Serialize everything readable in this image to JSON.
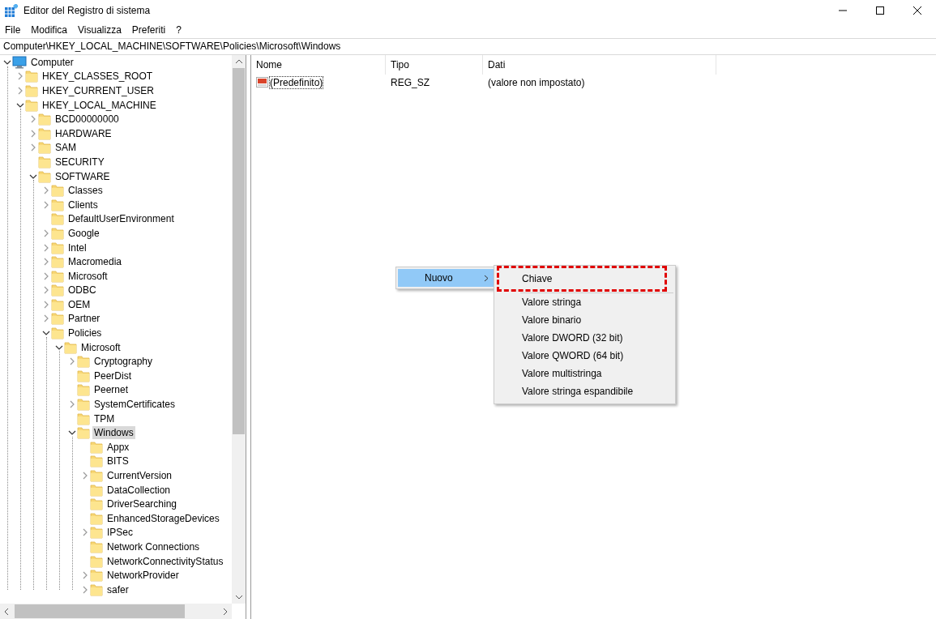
{
  "window": {
    "title": "Editor del Registro di sistema"
  },
  "menu": [
    "File",
    "Modifica",
    "Visualizza",
    "Preferiti",
    "?"
  ],
  "address_bar": {
    "value": "Computer\\HKEY_LOCAL_MACHINE\\SOFTWARE\\Policies\\Microsoft\\Windows"
  },
  "tree": [
    {
      "label": "Computer",
      "kind": "computer",
      "expanded": true,
      "selected": false,
      "children": [
        {
          "label": "HKEY_CLASSES_ROOT",
          "expanded": false,
          "selected": false
        },
        {
          "label": "HKEY_CURRENT_USER",
          "expanded": false,
          "selected": false
        },
        {
          "label": "HKEY_LOCAL_MACHINE",
          "expanded": true,
          "selected": false,
          "children": [
            {
              "label": "BCD00000000",
              "expanded": false,
              "selected": false
            },
            {
              "label": "HARDWARE",
              "expanded": false,
              "selected": false
            },
            {
              "label": "SAM",
              "expanded": false,
              "selected": false
            },
            {
              "label": "SECURITY",
              "selected": false
            },
            {
              "label": "SOFTWARE",
              "expanded": true,
              "selected": false,
              "children": [
                {
                  "label": "Classes",
                  "expanded": false,
                  "selected": false
                },
                {
                  "label": "Clients",
                  "expanded": false,
                  "selected": false
                },
                {
                  "label": "DefaultUserEnvironment",
                  "selected": false
                },
                {
                  "label": "Google",
                  "expanded": false,
                  "selected": false
                },
                {
                  "label": "Intel",
                  "expanded": false,
                  "selected": false
                },
                {
                  "label": "Macromedia",
                  "expanded": false,
                  "selected": false
                },
                {
                  "label": "Microsoft",
                  "expanded": false,
                  "selected": false
                },
                {
                  "label": "ODBC",
                  "expanded": false,
                  "selected": false
                },
                {
                  "label": "OEM",
                  "expanded": false,
                  "selected": false
                },
                {
                  "label": "Partner",
                  "expanded": false,
                  "selected": false
                },
                {
                  "label": "Policies",
                  "expanded": true,
                  "selected": false,
                  "children": [
                    {
                      "label": "Microsoft",
                      "expanded": true,
                      "selected": false,
                      "children": [
                        {
                          "label": "Cryptography",
                          "expanded": false,
                          "selected": false
                        },
                        {
                          "label": "PeerDist",
                          "selected": false
                        },
                        {
                          "label": "Peernet",
                          "selected": false
                        },
                        {
                          "label": "SystemCertificates",
                          "expanded": false,
                          "selected": false
                        },
                        {
                          "label": "TPM",
                          "selected": false
                        },
                        {
                          "label": "Windows",
                          "expanded": true,
                          "selected": true,
                          "children": [
                            {
                              "label": "Appx",
                              "selected": false
                            },
                            {
                              "label": "BITS",
                              "selected": false
                            },
                            {
                              "label": "CurrentVersion",
                              "expanded": false,
                              "selected": false
                            },
                            {
                              "label": "DataCollection",
                              "selected": false
                            },
                            {
                              "label": "DriverSearching",
                              "selected": false
                            },
                            {
                              "label": "EnhancedStorageDevices",
                              "selected": false
                            },
                            {
                              "label": "IPSec",
                              "expanded": false,
                              "selected": false
                            },
                            {
                              "label": "Network Connections",
                              "selected": false
                            },
                            {
                              "label": "NetworkConnectivityStatus",
                              "selected": false
                            },
                            {
                              "label": "NetworkProvider",
                              "expanded": false,
                              "selected": false
                            },
                            {
                              "label": "safer",
                              "expanded": false,
                              "selected": false
                            }
                          ]
                        }
                      ]
                    }
                  ]
                }
              ]
            }
          ]
        }
      ]
    }
  ],
  "values_table": {
    "columns": [
      "Nome",
      "Tipo",
      "Dati"
    ],
    "rows": [
      {
        "name": "(Predefinito)",
        "type": "REG_SZ",
        "data": "(valore non impostato)",
        "focused": true
      }
    ]
  },
  "context_menu": {
    "items": [
      {
        "label": "Nuovo",
        "selected": true
      }
    ],
    "submenu": {
      "items": [
        {
          "label": "Chiave",
          "annotated": true
        },
        {
          "label": "Valore stringa",
          "annotated": false
        },
        {
          "label": "Valore binario",
          "annotated": false
        },
        {
          "label": "Valore DWORD (32 bit)",
          "annotated": false
        },
        {
          "label": "Valore QWORD (64 bit)",
          "annotated": false
        },
        {
          "label": "Valore multistringa",
          "annotated": false
        },
        {
          "label": "Valore stringa espandibile",
          "annotated": false
        }
      ]
    }
  }
}
